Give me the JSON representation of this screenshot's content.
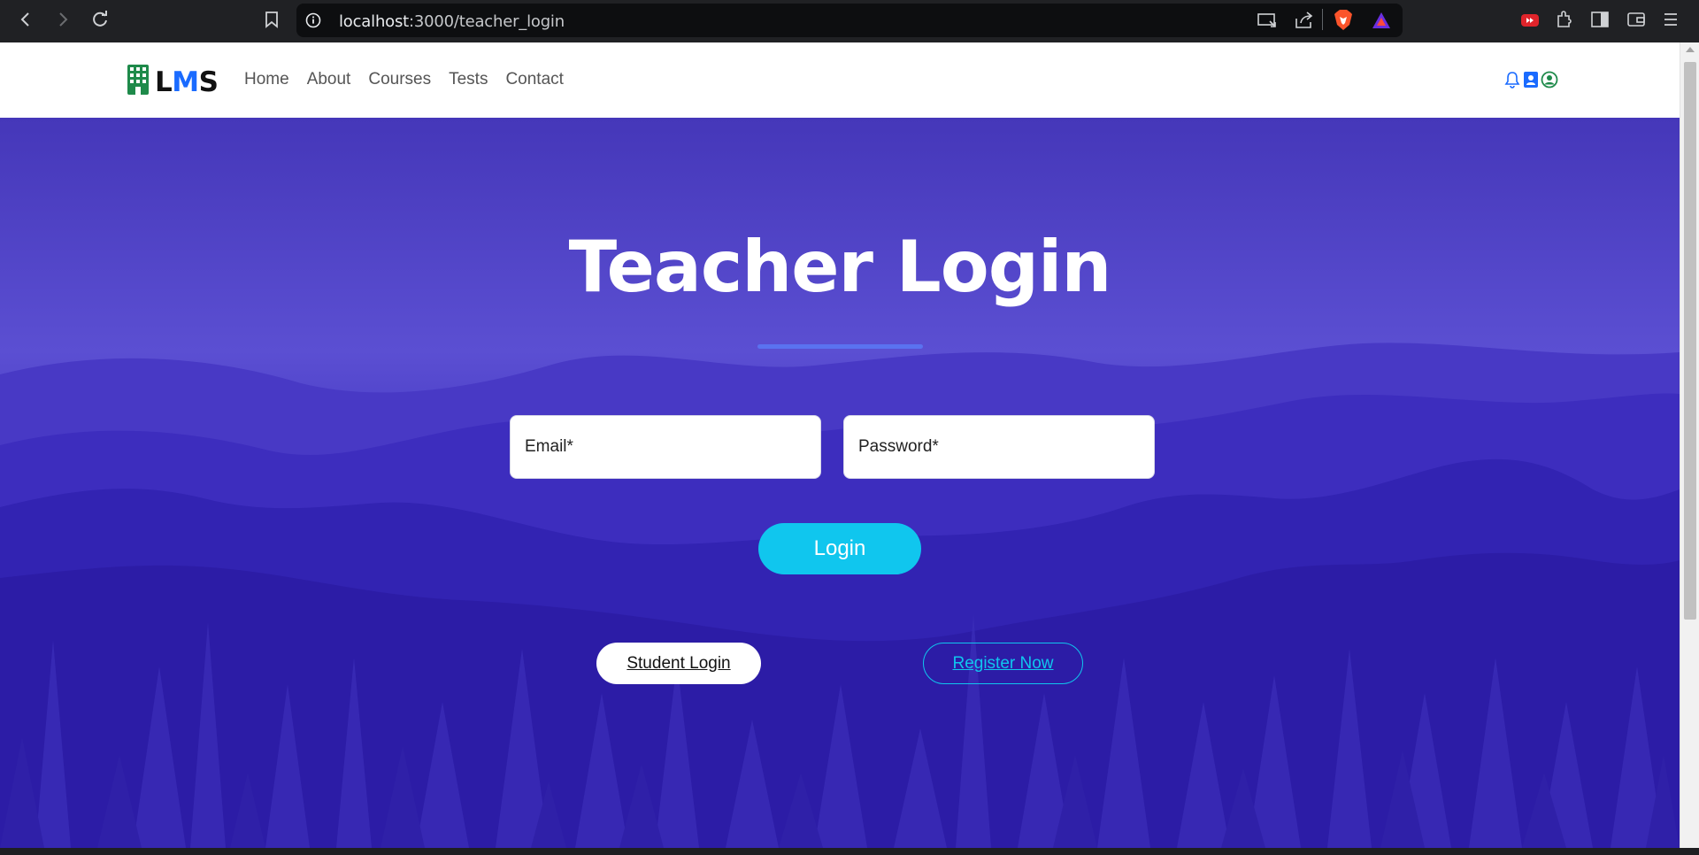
{
  "browser": {
    "url_host": "localhost",
    "url_path": ":3000/teacher_login"
  },
  "navbar": {
    "brand": {
      "l": "L",
      "m": "M",
      "s": "S"
    },
    "links": [
      "Home",
      "About",
      "Courses",
      "Tests",
      "Contact"
    ]
  },
  "hero": {
    "title": "Teacher Login",
    "email_placeholder": "Email*",
    "password_placeholder": "Password*",
    "login_label": "Login",
    "student_login_label": "Student Login",
    "register_label": "Register Now"
  },
  "colors": {
    "accent": "#10c6ee",
    "hero_top": "#4d3ec8",
    "hero_bottom": "#2a1aa0",
    "brand_m": "#1a6bff"
  },
  "icons": {
    "toolbar": [
      "back-icon",
      "forward-icon",
      "reload-icon",
      "bookmark-icon",
      "info-icon",
      "cast-icon",
      "share-icon",
      "brave-shield-icon",
      "brave-rewards-icon",
      "youtube-ext-icon",
      "extensions-icon",
      "sidebar-icon",
      "wallet-icon",
      "menu-icon"
    ],
    "nav": [
      "bell-icon",
      "teacher-badge-icon",
      "user-circle-icon"
    ]
  }
}
